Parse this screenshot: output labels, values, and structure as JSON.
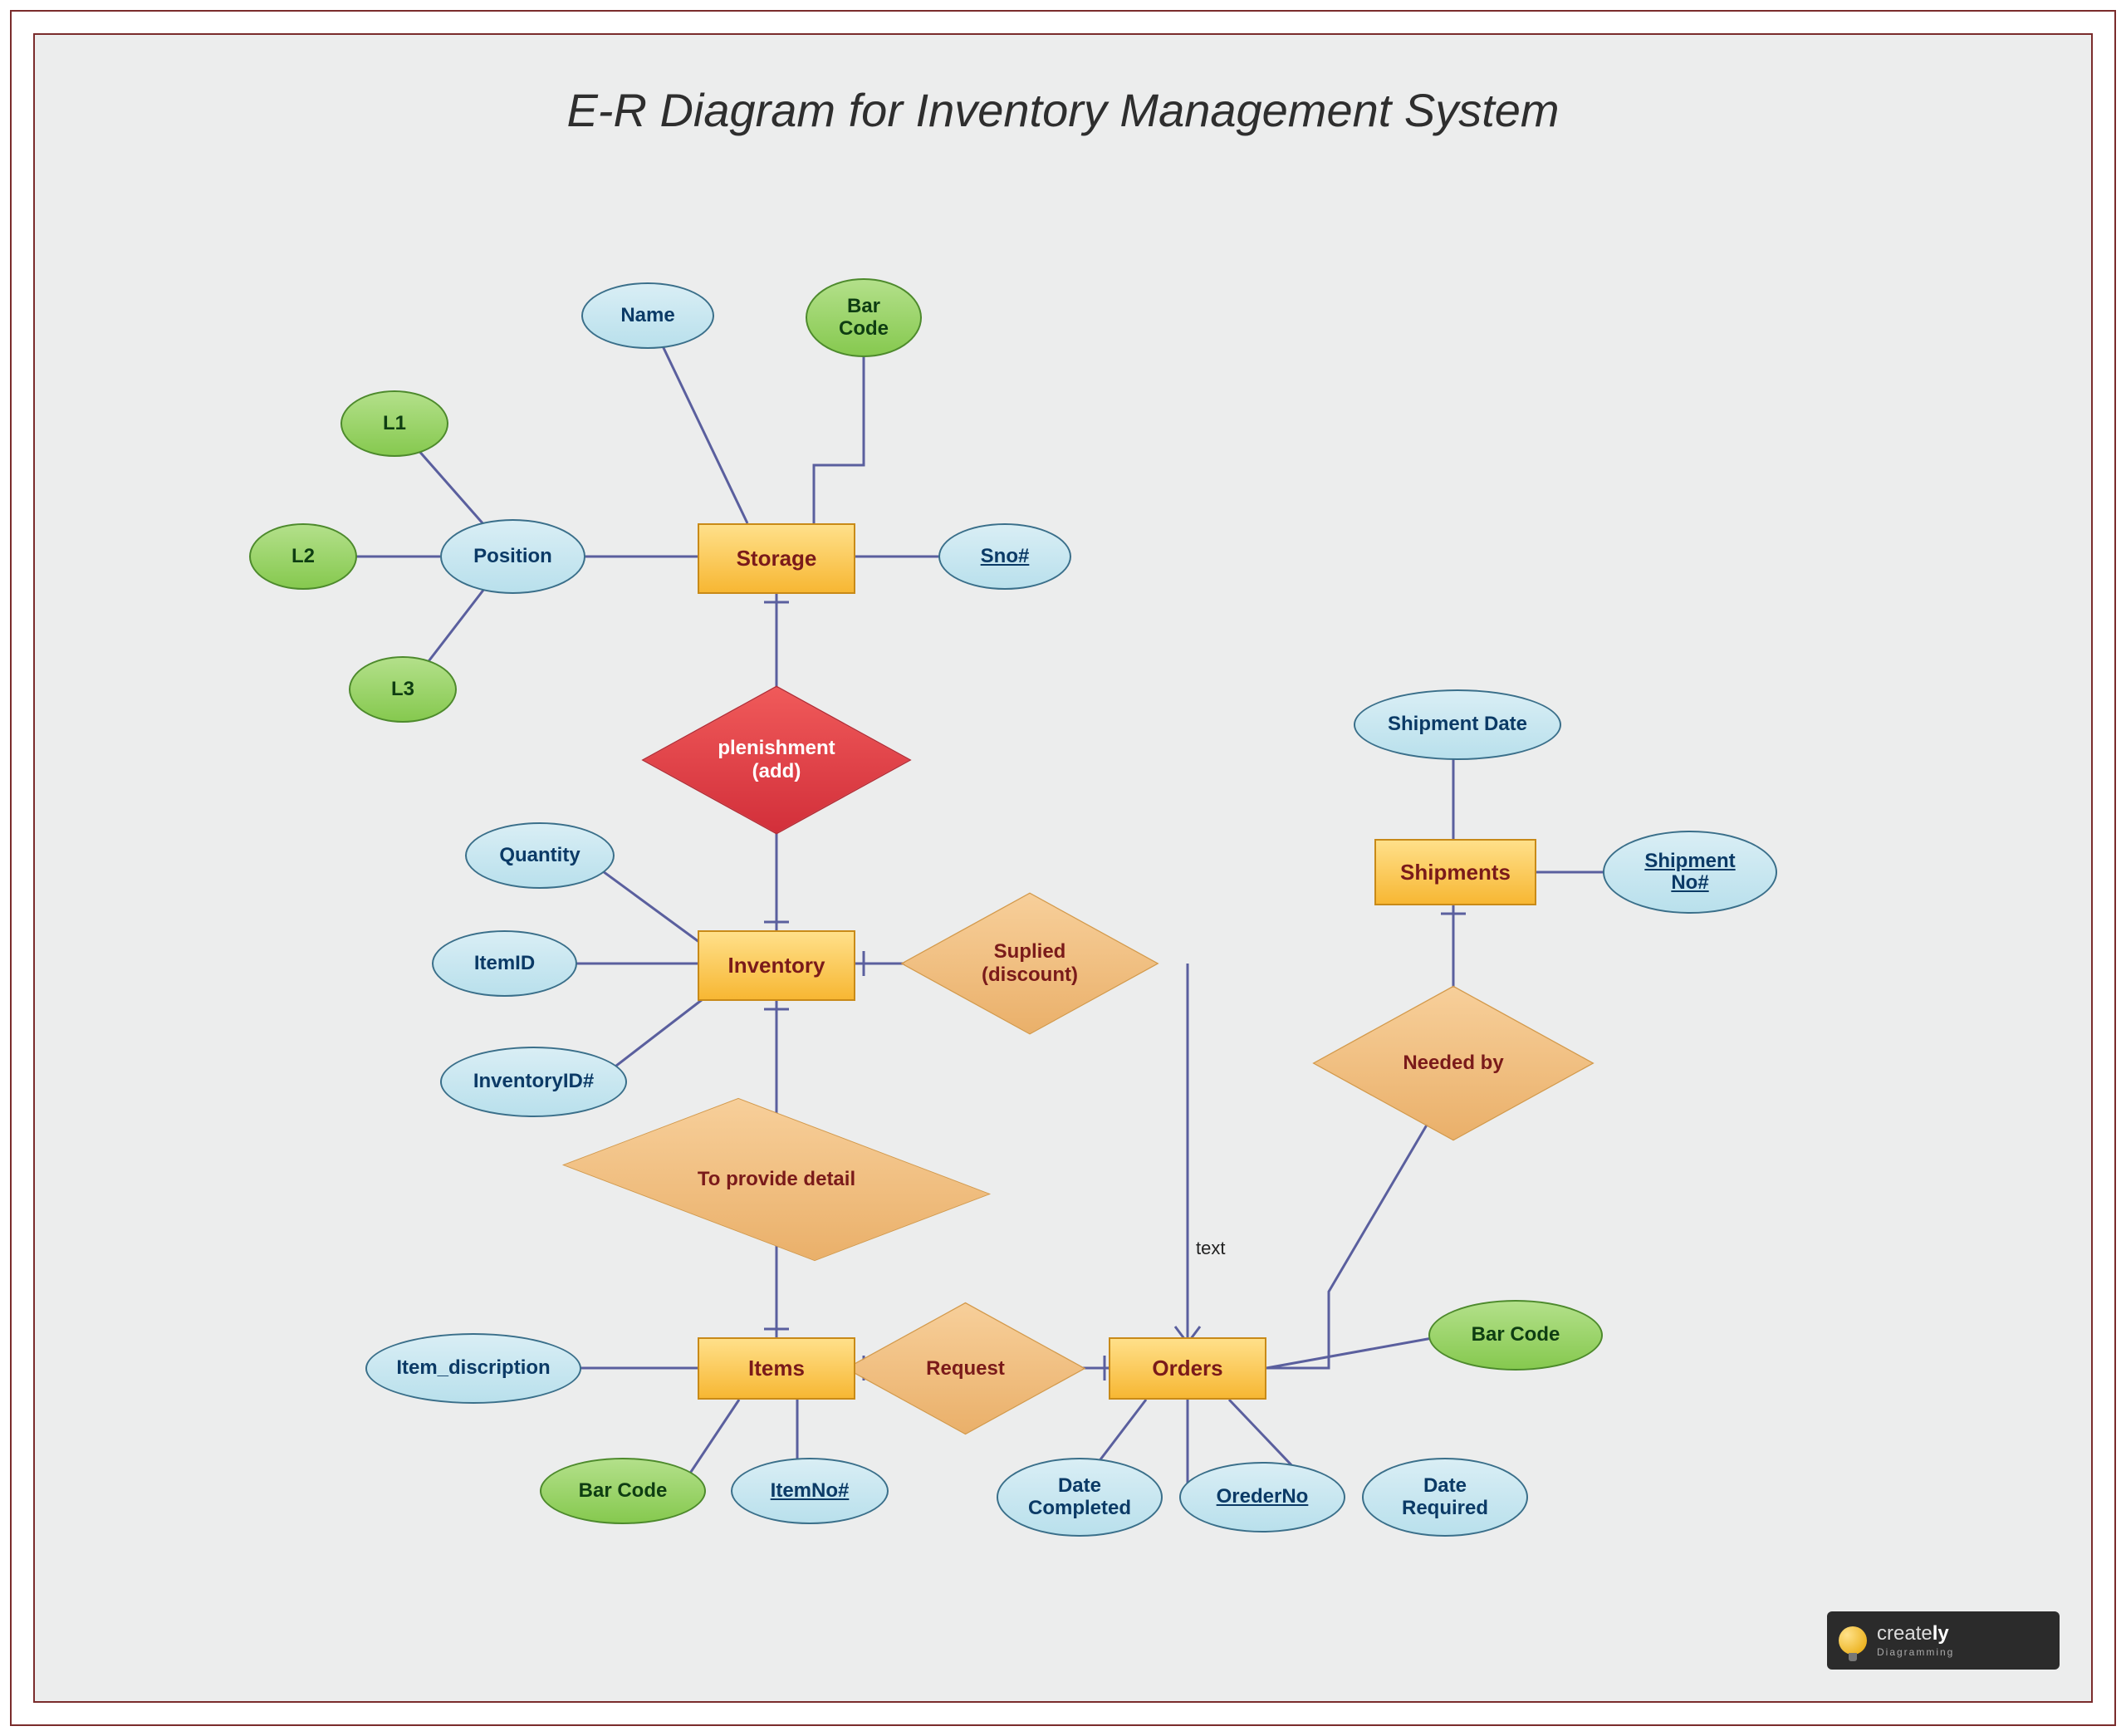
{
  "title": "E-R Diagram for Inventory Management System",
  "entities": {
    "storage": "Storage",
    "inventory": "Inventory",
    "items": "Items",
    "orders": "Orders",
    "shipments": "Shipments"
  },
  "relationships": {
    "replenishment": "plenishment\n(add)",
    "supplied": "Suplied\n(discount)",
    "provide_detail": "To provide detail",
    "request": "Request",
    "needed_by": "Needed by"
  },
  "attributes": {
    "storage": {
      "name": "Name",
      "barcode": "Bar\nCode",
      "sno": "Sno#",
      "position": "Position",
      "l1": "L1",
      "l2": "L2",
      "l3": "L3"
    },
    "inventory": {
      "quantity": "Quantity",
      "item_id": "ItemID",
      "inventory_id": "InventoryID#"
    },
    "items": {
      "description": "Item_discription",
      "barcode": "Bar Code",
      "item_no": "ItemNo#"
    },
    "orders": {
      "date_completed": "Date\nCompleted",
      "order_no": "OrederNo",
      "date_required": "Date\nRequired",
      "barcode": "Bar Code"
    },
    "shipments": {
      "shipment_date": "Shipment Date",
      "shipment_no": "Shipment\nNo#"
    }
  },
  "labels": {
    "text": "text"
  },
  "logo": {
    "main_light": "create",
    "main_bold": "ly",
    "sub": "Diagramming"
  },
  "colors": {
    "entity_fill": "#f7b733",
    "entity_text": "#7a1a1a",
    "rel_orange": "#eab06a",
    "rel_red": "#d22f3a",
    "attr_blue": "#b9e0ec",
    "attr_green": "#86c94f",
    "connector": "#5a5f9e",
    "border": "#7a2c2c"
  }
}
